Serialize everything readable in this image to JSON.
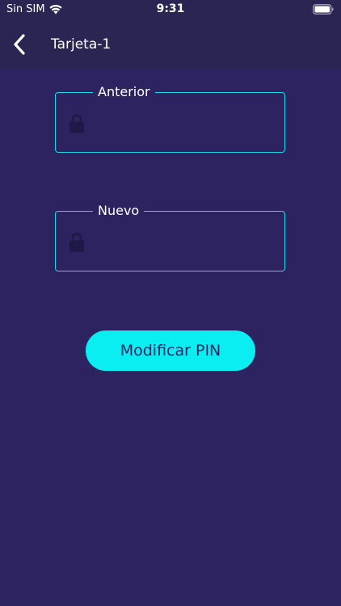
{
  "status_bar": {
    "carrier": "Sin SIM",
    "time": "9:31",
    "icons": [
      "wifi-icon",
      "battery-icon"
    ]
  },
  "nav": {
    "back_icon": "chevron-left-icon",
    "title": "Tarjeta-1"
  },
  "form": {
    "fields": [
      {
        "label": "Anterior",
        "value": "",
        "icon": "lock-icon"
      },
      {
        "label": "Nuevo",
        "value": "",
        "icon": "lock-icon"
      }
    ],
    "submit_label": "Modificar PIN"
  },
  "colors": {
    "background": "#2d2360",
    "header": "#2a2552",
    "accent": "#0aeef2",
    "field_border": "#1fd8e8",
    "lock_icon": "#1e1946"
  }
}
